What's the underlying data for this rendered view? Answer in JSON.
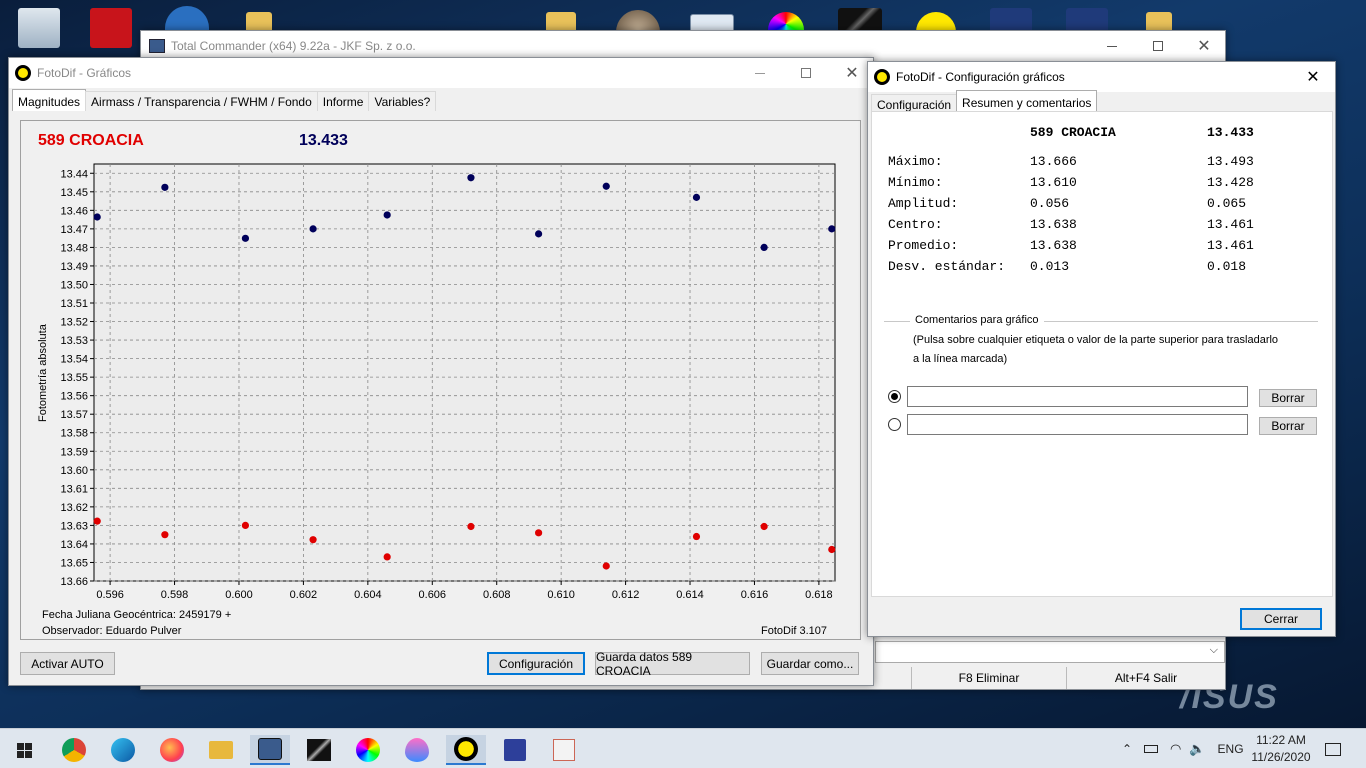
{
  "tc": {
    "title": "Total Commander (x64) 9.22a - JKF Sp. z o.o.",
    "f8": "F8 Eliminar",
    "altf4": "Alt+F4 Salir"
  },
  "graficos": {
    "title": "FotoDif - Gráficos",
    "tabs": [
      "Magnitudes",
      "Airmass / Transparencia / FWHM / Fondo",
      "Informe",
      "Variables?"
    ],
    "star_label": "589 CROACIA",
    "star_value": "13.433",
    "y_axis_label": "Fotometría absoluta",
    "jd_label": "Fecha Juliana Geocéntrica: 2459179 +",
    "observer": "Observador: Eduardo Pulver",
    "version": "FotoDif 3.107",
    "buttons": {
      "auto": "Activar AUTO",
      "config": "Configuración",
      "save_data": "Guarda datos 589 CROACIA",
      "save_as": "Guardar como..."
    }
  },
  "config": {
    "title": "FotoDif - Configuración gráficos",
    "tabs": [
      "Configuración",
      "Resumen y comentarios"
    ],
    "header_name": "589 CROACIA",
    "header_value": "13.433",
    "stats": [
      {
        "label": "Máximo:",
        "a": "13.666",
        "b": "13.493"
      },
      {
        "label": "Mínimo:",
        "a": "13.610",
        "b": "13.428"
      },
      {
        "label": "Amplitud:",
        "a": "0.056",
        "b": "0.065"
      },
      {
        "label": "Centro:",
        "a": "13.638",
        "b": "13.461"
      },
      {
        "label": "Promedio:",
        "a": "13.638",
        "b": "13.461"
      },
      {
        "label": "Desv. estándar:",
        "a": "0.013",
        "b": "0.018"
      }
    ],
    "comments_title": "Comentarios para gráfico",
    "comments_hint_1": "(Pulsa sobre cualquier etiqueta o valor de la parte superior para trasladarlo",
    "comments_hint_2": "a la línea marcada)",
    "borrar": "Borrar",
    "cerrar": "Cerrar"
  },
  "taskbar": {
    "time": "11:22 AM",
    "date": "11/26/2020",
    "lang": "ENG"
  },
  "brand": "/ISUS",
  "colors": {
    "red_series": "#e00000",
    "blue_series": "#00005a",
    "accent": "#0078d7"
  },
  "chart_data": {
    "type": "scatter",
    "xlim": [
      0.5955,
      0.6185
    ],
    "ylim": [
      13.66,
      13.435
    ],
    "y_inverted": true,
    "xticks": [
      "0.596",
      "0.598",
      "0.600",
      "0.602",
      "0.604",
      "0.606",
      "0.608",
      "0.610",
      "0.612",
      "0.614",
      "0.616",
      "0.618"
    ],
    "yticks": [
      "13.44",
      "13.45",
      "13.46",
      "13.47",
      "13.48",
      "13.49",
      "13.50",
      "13.51",
      "13.52",
      "13.53",
      "13.54",
      "13.55",
      "13.56",
      "13.57",
      "13.58",
      "13.59",
      "13.60",
      "13.61",
      "13.62",
      "13.63",
      "13.64",
      "13.65",
      "13.66"
    ],
    "grid": true,
    "series": [
      {
        "color": "#00005a",
        "points": [
          [
            0.5956,
            13.4636
          ],
          [
            0.5977,
            13.4476
          ],
          [
            0.6002,
            13.4751
          ],
          [
            0.6023,
            13.47
          ],
          [
            0.6046,
            13.4625
          ],
          [
            0.6072,
            13.4424
          ],
          [
            0.6093,
            13.4727
          ],
          [
            0.6114,
            13.447
          ],
          [
            0.6142,
            13.453
          ],
          [
            0.6163,
            13.48
          ],
          [
            0.6184,
            13.47
          ]
        ]
      },
      {
        "color": "#e00000",
        "points": [
          [
            0.5956,
            13.6277
          ],
          [
            0.5977,
            13.635
          ],
          [
            0.6002,
            13.63
          ],
          [
            0.6023,
            13.6377
          ],
          [
            0.6046,
            13.647
          ],
          [
            0.6072,
            13.6306
          ],
          [
            0.6093,
            13.634
          ],
          [
            0.6114,
            13.6519
          ],
          [
            0.6142,
            13.636
          ],
          [
            0.6163,
            13.6306
          ],
          [
            0.6184,
            13.643
          ]
        ]
      }
    ]
  }
}
